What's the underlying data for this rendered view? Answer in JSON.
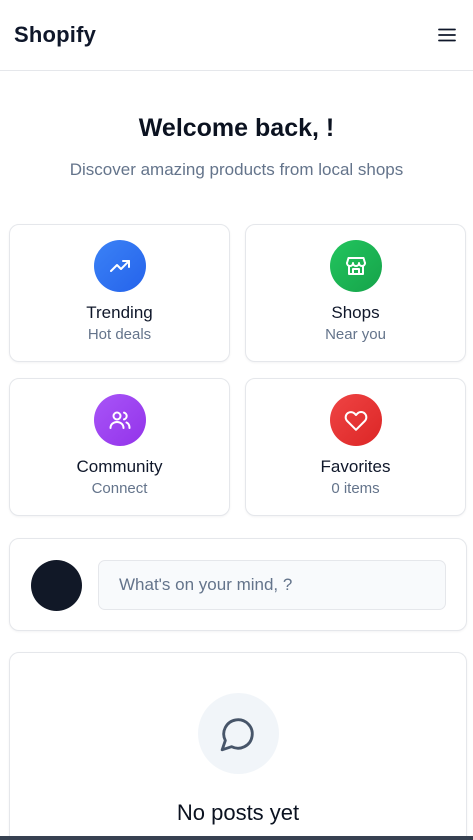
{
  "header": {
    "brand": "Shopify",
    "menu_icon": "menu-icon"
  },
  "hero": {
    "title": "Welcome back, !",
    "subtitle": "Discover amazing products from local shops"
  },
  "quick_links": [
    {
      "title": "Trending",
      "subtitle": "Hot deals",
      "icon": "trending-up-icon",
      "color": "#2563eb"
    },
    {
      "title": "Shops",
      "subtitle": "Near you",
      "icon": "store-icon",
      "color": "#16a34a"
    },
    {
      "title": "Community",
      "subtitle": "Connect",
      "icon": "users-icon",
      "color": "#9333ea"
    },
    {
      "title": "Favorites",
      "subtitle": "0 items",
      "icon": "heart-icon",
      "color": "#dc2626"
    }
  ],
  "composer": {
    "placeholder": "What's on your mind, ?"
  },
  "feed": {
    "empty_title": "No posts yet",
    "empty_icon": "message-circle-icon"
  }
}
